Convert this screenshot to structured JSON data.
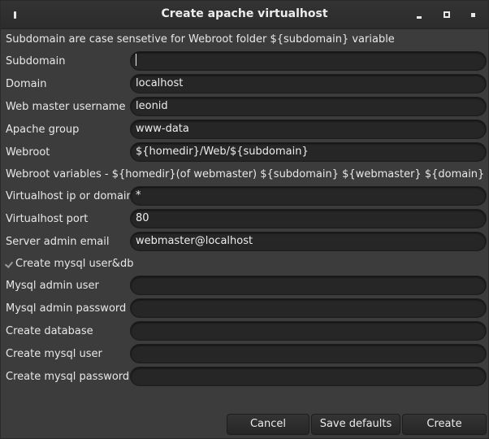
{
  "window": {
    "title": "Create apache virtualhost"
  },
  "info_text": "Subdomain are case sensetive for Webroot folder ${subdomain} variable",
  "webroot_vars_text": "Webroot variables - ${homedir}(of webmaster) ${subdomain} ${webmaster} ${domain}",
  "fields": {
    "subdomain": {
      "label": "Subdomain",
      "value": ""
    },
    "domain": {
      "label": "Domain",
      "value": "localhost"
    },
    "webmaster": {
      "label": "Web master username",
      "value": "leonid"
    },
    "apache_group": {
      "label": "Apache group",
      "value": "www-data"
    },
    "webroot": {
      "label": "Webroot",
      "value": "${homedir}/Web/${subdomain}"
    },
    "vhost_ip": {
      "label": "Virtualhost ip or domain",
      "value": "*"
    },
    "vhost_port": {
      "label": "Virtualhost port",
      "value": "80"
    },
    "admin_email": {
      "label": "Server admin email",
      "value": "webmaster@localhost"
    },
    "mysql_admin_user": {
      "label": "Mysql admin user",
      "value": ""
    },
    "mysql_admin_password": {
      "label": "Mysql admin password",
      "value": ""
    },
    "create_database": {
      "label": "Create database",
      "value": ""
    },
    "create_mysql_user": {
      "label": "Create mysql user",
      "value": ""
    },
    "create_mysql_password": {
      "label": "Create mysql password",
      "value": ""
    }
  },
  "mysql_checkbox": {
    "label": "Create mysql user&db",
    "checked": true
  },
  "buttons": {
    "cancel": "Cancel",
    "save_defaults": "Save defaults",
    "create": "Create"
  }
}
